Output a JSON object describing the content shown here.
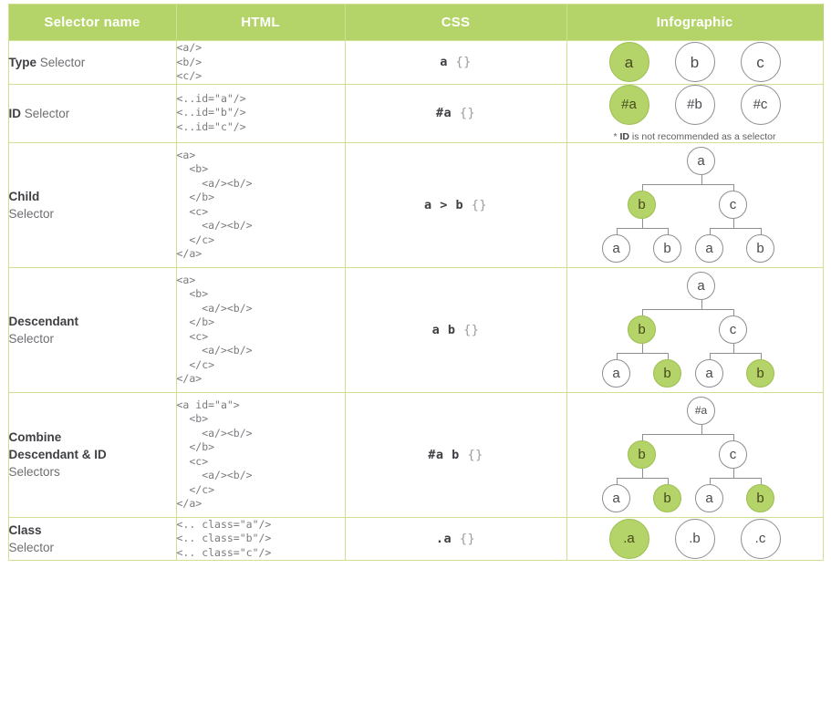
{
  "header": {
    "columns": [
      "Selector name",
      "HTML",
      "CSS",
      "Infographic"
    ]
  },
  "colors": {
    "accent_green": "#b4d368",
    "border_green": "#cfe191",
    "node_stroke": "#8d8e92",
    "text_dark": "#3f4044",
    "text_gray": "#6d6e71"
  },
  "rows": [
    {
      "name_strong": "Type",
      "name_rest": " Selector",
      "html": "<a/>\n<b/>\n<c/>",
      "css_selector": "a",
      "css_braces": " {}",
      "infographic": {
        "kind": "circles",
        "nodes": [
          {
            "label": "a",
            "green": true
          },
          {
            "label": "b",
            "green": false
          },
          {
            "label": "c",
            "green": false
          }
        ],
        "footnote": ""
      }
    },
    {
      "name_strong": "ID",
      "name_rest": " Selector",
      "html": "<..id=\"a\"/>\n<..id=\"b\"/>\n<..id=\"c\"/>",
      "css_selector": "#a",
      "css_braces": " {}",
      "infographic": {
        "kind": "circles",
        "nodes": [
          {
            "label": "#a",
            "green": true
          },
          {
            "label": "#b",
            "green": false
          },
          {
            "label": "#c",
            "green": false
          }
        ],
        "footnote_star": "* ",
        "footnote_bold": "ID",
        "footnote_rest": " is not recommended as a selector"
      }
    },
    {
      "name_strong": "Child",
      "name_rest": "Selector",
      "html": "<a>\n  <b>\n    <a/><b/>\n  </b>\n  <c>\n    <a/><b/>\n  </c>\n</a>",
      "css_selector": "a > b",
      "css_braces": " {}",
      "infographic": {
        "kind": "tree",
        "root": {
          "label": "a",
          "green": false
        },
        "level2": [
          {
            "label": "b",
            "green": true
          },
          {
            "label": "c",
            "green": false
          }
        ],
        "level3": [
          {
            "label": "a",
            "green": false
          },
          {
            "label": "b",
            "green": false
          },
          {
            "label": "a",
            "green": false
          },
          {
            "label": "b",
            "green": false
          }
        ]
      }
    },
    {
      "name_strong": "Descendant",
      "name_rest": "Selector",
      "html": "<a>\n  <b>\n    <a/><b/>\n  </b>\n  <c>\n    <a/><b/>\n  </c>\n</a>",
      "css_selector": "a  b",
      "css_braces": " {}",
      "infographic": {
        "kind": "tree",
        "root": {
          "label": "a",
          "green": false
        },
        "level2": [
          {
            "label": "b",
            "green": true
          },
          {
            "label": "c",
            "green": false
          }
        ],
        "level3": [
          {
            "label": "a",
            "green": false
          },
          {
            "label": "b",
            "green": true
          },
          {
            "label": "a",
            "green": false
          },
          {
            "label": "b",
            "green": true
          }
        ]
      }
    },
    {
      "name_strong": "Combine\nDescendant & ID",
      "name_rest": "Selectors",
      "html": "<a id=\"a\">\n  <b>\n    <a/><b/>\n  </b>\n  <c>\n    <a/><b/>\n  </c>\n</a>",
      "css_selector": "#a  b",
      "css_braces": " {}",
      "infographic": {
        "kind": "tree",
        "root": {
          "label": "#a",
          "green": false
        },
        "level2": [
          {
            "label": "b",
            "green": true
          },
          {
            "label": "c",
            "green": false
          }
        ],
        "level3": [
          {
            "label": "a",
            "green": false
          },
          {
            "label": "b",
            "green": true
          },
          {
            "label": "a",
            "green": false
          },
          {
            "label": "b",
            "green": true
          }
        ]
      }
    },
    {
      "name_strong": "Class",
      "name_rest": "Selector",
      "html": "<.. class=\"a\"/>\n<.. class=\"b\"/>\n<.. class=\"c\"/>",
      "css_selector": ".a",
      "css_braces": " {}",
      "infographic": {
        "kind": "circles",
        "nodes": [
          {
            "label": ".a",
            "green": true
          },
          {
            "label": ".b",
            "green": false
          },
          {
            "label": ".c",
            "green": false
          }
        ],
        "footnote": ""
      }
    }
  ]
}
